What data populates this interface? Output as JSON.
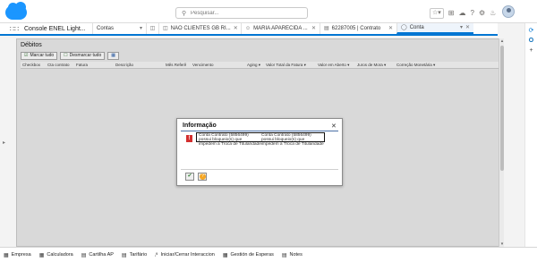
{
  "header": {
    "search_placeholder": "Pesquisar...",
    "icons": [
      "star-icon",
      "add-icon",
      "cloud-icon",
      "help-icon",
      "settings-icon",
      "bell-icon"
    ]
  },
  "nav": {
    "app_name": "Console ENEL Light...",
    "tabs": [
      {
        "label": "Contas",
        "icon": "",
        "has_close": false,
        "chevron": true
      },
      {
        "label": "NAO CLIENTES GB RI...",
        "icon": "briefcase-icon",
        "has_close": true
      },
      {
        "label": "MARIA APARECIDA ...",
        "icon": "contact-icon",
        "has_close": true
      },
      {
        "label": "62287005 | Contrato",
        "icon": "contract-icon",
        "has_close": true
      },
      {
        "label": "Conta",
        "icon": "account-icon",
        "has_close": true,
        "active": true
      }
    ]
  },
  "panel": {
    "title": "Débitos",
    "buttons": {
      "mark_all": "Marcar tudo",
      "unmark_all": "Desmarcar tudo"
    },
    "columns": [
      "Checkbox",
      "Cta contrato",
      "Fatura",
      "Descrição",
      "Mês Referê",
      "Vencimento",
      "Aging ▾",
      "Valor Total da Fatura ▾",
      "Valor em Aberto ▾",
      "Juros de Mora ▾",
      "Correção Monetária ▾"
    ]
  },
  "dialog": {
    "title": "Informação",
    "msg_col1": "Conta Contrato (5856499) possui bloqueio(s) que",
    "msg_col2": "Conta Contrato (5856499) possui bloqueio(s) que",
    "msg_line3": "impedem a Troca de Titularidadeimpedem a Troca de Titularidade"
  },
  "utility_bar": {
    "items": [
      {
        "label": "Empresa",
        "icon": "building-icon"
      },
      {
        "label": "Calculadora",
        "icon": "calculator-icon"
      },
      {
        "label": "Cartilha AP",
        "icon": "book-icon"
      },
      {
        "label": "Tarifário",
        "icon": "tariff-icon"
      },
      {
        "label": "Iniciar/Cerrar Interaccion",
        "icon": "lightning-icon"
      },
      {
        "label": "Gestión de Esperas",
        "icon": "queue-icon"
      },
      {
        "label": "Notes",
        "icon": "notes-icon"
      }
    ]
  }
}
